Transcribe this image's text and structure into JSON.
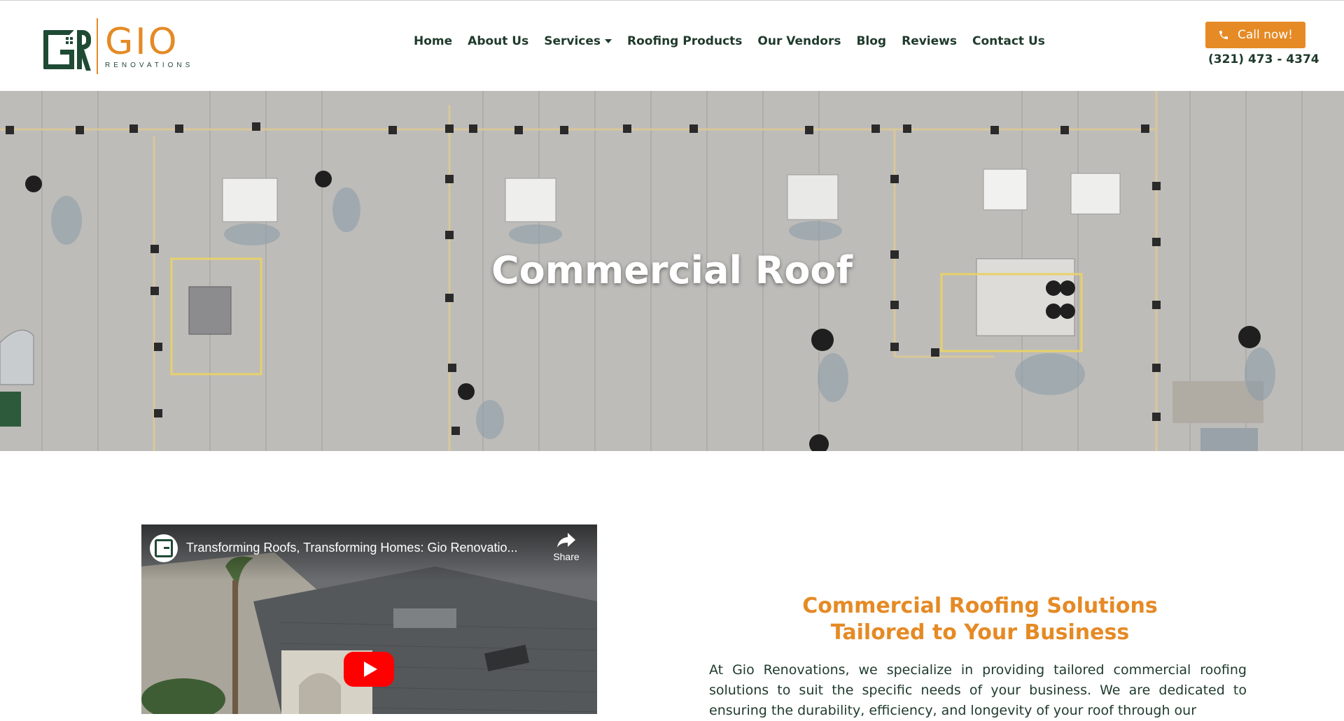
{
  "header": {
    "logo": {
      "word": "GIO",
      "subtitle": "RENOVATIONS"
    },
    "nav": [
      {
        "label": "Home"
      },
      {
        "label": "About Us"
      },
      {
        "label": "Services",
        "has_dropdown": true
      },
      {
        "label": "Roofing Products"
      },
      {
        "label": "Our Vendors"
      },
      {
        "label": "Blog"
      },
      {
        "label": "Reviews"
      },
      {
        "label": "Contact Us"
      }
    ],
    "cta": {
      "label": "Call now!",
      "icon": "phone-icon"
    },
    "phone": "(321) 473 - 4374"
  },
  "hero": {
    "title": "Commercial Roof"
  },
  "video": {
    "title": "Transforming Roofs, Transforming Homes: Gio Renovatio...",
    "share_label": "Share",
    "play_icon": "youtube-play-icon"
  },
  "solutions": {
    "title_line1": "Commercial Roofing Solutions",
    "title_line2": "Tailored to Your Business",
    "body": "At Gio Renovations, we specialize in providing tailored commercial roofing solutions to suit the specific needs of your business. We are dedicated to ensuring the durability, efficiency, and longevity of your roof through our"
  },
  "colors": {
    "brand_green": "#1f4a34",
    "accent_orange": "#e58a25",
    "text_dark": "#1f3a2c"
  }
}
